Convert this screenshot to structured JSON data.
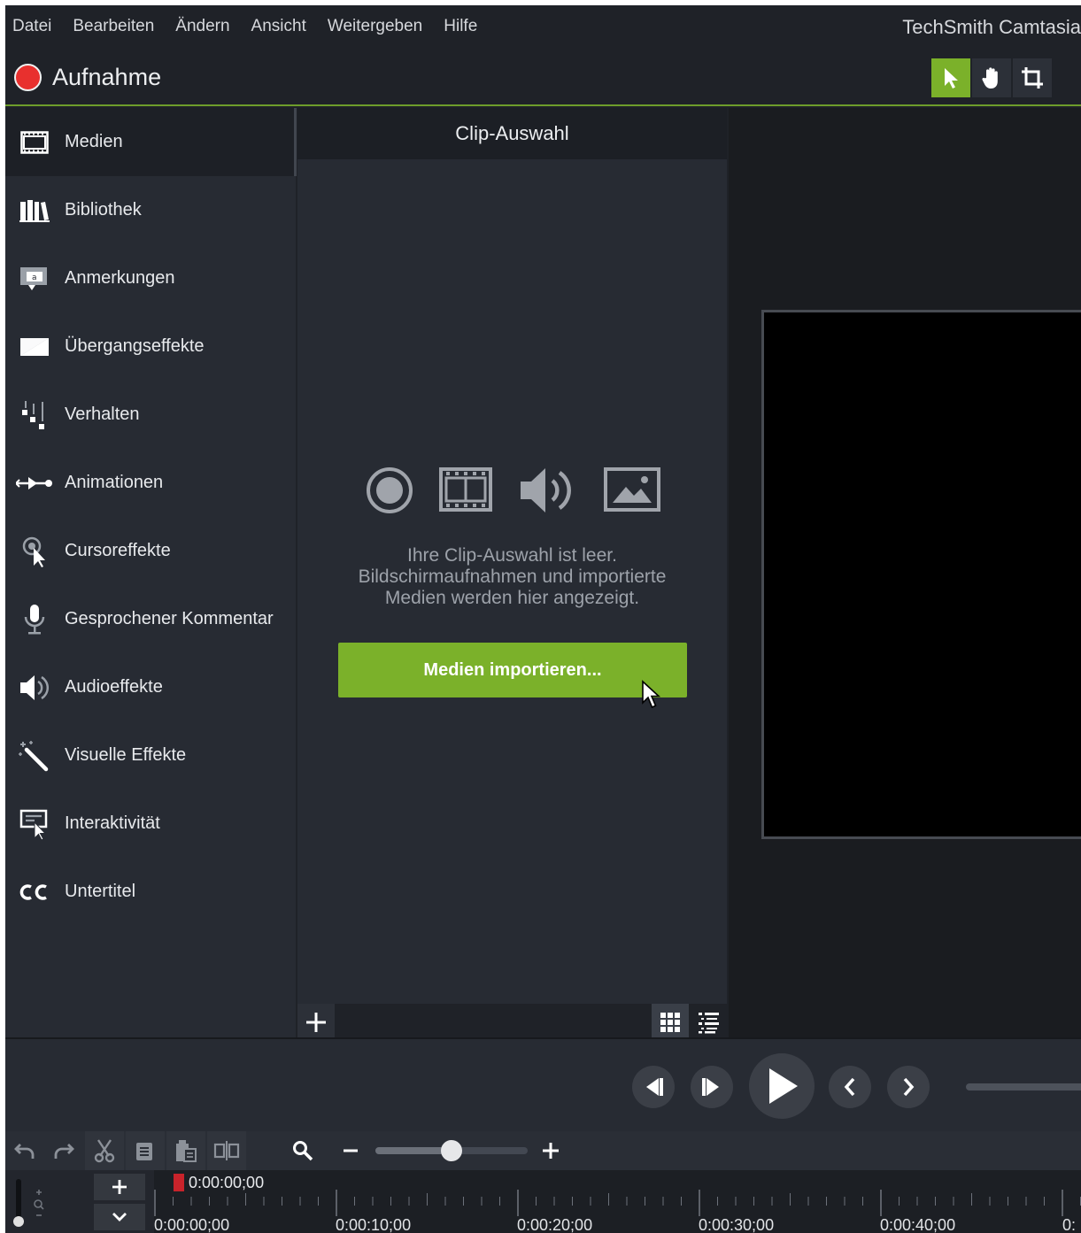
{
  "app": {
    "title": "TechSmith Camtasia"
  },
  "menu": {
    "items": [
      "Datei",
      "Bearbeiten",
      "Ändern",
      "Ansicht",
      "Weitergeben",
      "Hilfe"
    ]
  },
  "record": {
    "label": "Aufnahme"
  },
  "canvas_tools": [
    {
      "icon": "pointer-icon",
      "active": true
    },
    {
      "icon": "hand-icon",
      "active": false
    },
    {
      "icon": "crop-icon",
      "active": false
    }
  ],
  "sidebar": {
    "items": [
      {
        "label": "Medien",
        "icon": "filmstrip-icon",
        "active": true
      },
      {
        "label": "Bibliothek",
        "icon": "library-icon"
      },
      {
        "label": "Anmerkungen",
        "icon": "callout-icon"
      },
      {
        "label": "Übergangseffekte",
        "icon": "transition-icon"
      },
      {
        "label": "Verhalten",
        "icon": "behavior-icon"
      },
      {
        "label": "Animationen",
        "icon": "animation-icon"
      },
      {
        "label": "Cursoreffekte",
        "icon": "cursor-effect-icon"
      },
      {
        "label": "Gesprochener Kommentar",
        "icon": "microphone-icon"
      },
      {
        "label": "Audioeffekte",
        "icon": "audio-effect-icon"
      },
      {
        "label": "Visuelle Effekte",
        "icon": "magic-wand-icon"
      },
      {
        "label": "Interaktivität",
        "icon": "interactivity-icon"
      },
      {
        "label": "Untertitel",
        "icon": "cc-icon"
      }
    ]
  },
  "clip_bin": {
    "title": "Clip-Auswahl",
    "empty_line1": "Ihre Clip-Auswahl ist leer.",
    "empty_line2": "Bildschirmaufnahmen und importierte",
    "empty_line3": "Medien werden hier angezeigt.",
    "import_label": "Medien importieren..."
  },
  "timeline": {
    "playhead": "0:00:00;00",
    "ticks": [
      "0:00:00;00",
      "0:00:10;00",
      "0:00:20;00",
      "0:00:30;00",
      "0:00:40;00",
      "0:"
    ],
    "zoom_level": 0.5
  },
  "colors": {
    "accent": "#7bb12a",
    "record": "#e8302e",
    "panel": "#272b33",
    "background": "#1f2228"
  }
}
